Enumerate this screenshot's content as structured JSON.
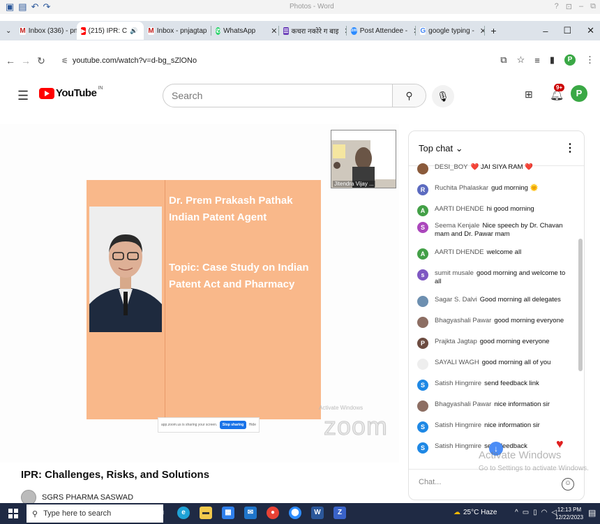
{
  "word": {
    "title": "Photos - Word",
    "qa_icons": [
      "save-icon",
      "undo-icon",
      "redo-icon"
    ],
    "controls": [
      "?",
      "▫",
      "–",
      "▫"
    ]
  },
  "tabs": [
    {
      "icon": "gmail-icon",
      "label": "Inbox (336) - pn",
      "color": "#c5221f"
    },
    {
      "icon": "youtube-icon",
      "label": "(215) IPR: C",
      "color": "#ff0000",
      "active": true
    },
    {
      "icon": "gmail-icon",
      "label": "Inbox - pnjagtap",
      "color": "#c5221f"
    },
    {
      "icon": "whatsapp-icon",
      "label": "WhatsApp",
      "color": "#25d366"
    },
    {
      "icon": "forms-icon",
      "label": "कचरा नकोरे ग बाइ",
      "color": "#673ab7"
    },
    {
      "icon": "zoom-icon",
      "label": "Post Attendee -",
      "color": "#2d8cff"
    },
    {
      "icon": "google-icon",
      "label": "google typing -",
      "color": "#4285f4"
    }
  ],
  "address": {
    "url": "youtube.com/watch?v=d-bg_sZlONo"
  },
  "youtube": {
    "logo_text": "YouTube",
    "region": "IN",
    "search_placeholder": "Search",
    "notif_count": "9+",
    "avatar_letter": "P"
  },
  "slide": {
    "name": "Dr. Prem Prakash Pathak",
    "role": "Indian Patent Agent",
    "topic_line1": "Topic: Case Study on Indian",
    "topic_line2": "Patent Act and Pharmacy",
    "share_text": "app.zoom.us is sharing your screen.",
    "stop_label": "Stop sharing",
    "hide_label": "Hide",
    "thumb_name": "Jitendra Vijay ..."
  },
  "player": {
    "activate_text": "Activate Windows",
    "zoom_watermark": "zoom"
  },
  "chat": {
    "header": "Top chat",
    "input_placeholder": "Chat...",
    "messages": [
      {
        "letter": "",
        "color": "#8a5a3b",
        "author": "DESI_BOY",
        "text": "❤️ JAI SIYA RAM ❤️"
      },
      {
        "letter": "R",
        "color": "#5c6bc0",
        "author": "Ruchita Phalaskar",
        "text": "gud morning 🌞"
      },
      {
        "letter": "A",
        "color": "#43a047",
        "author": "AARTI DHENDE",
        "text": "hi good morning"
      },
      {
        "letter": "S",
        "color": "#ab47bc",
        "author": "Seema Kenjale",
        "text": "Nice speech by Dr. Chavan mam and Dr. Pawar mam"
      },
      {
        "letter": "A",
        "color": "#43a047",
        "author": "AARTI DHENDE",
        "text": "welcome all"
      },
      {
        "letter": "s",
        "color": "#7e57c2",
        "author": "sumit musale",
        "text": "good morning and welcome to all"
      },
      {
        "letter": "",
        "color": "#6d8fb0",
        "author": "Sagar S. Dalvi",
        "text": "Good morning all delegates"
      },
      {
        "letter": "",
        "color": "#8d6e63",
        "author": "Bhagyashali Pawar",
        "text": "good morning everyone"
      },
      {
        "letter": "P",
        "color": "#6d4c41",
        "author": "Prajkta Jagtap",
        "text": "good morning everyone"
      },
      {
        "letter": "",
        "color": "#eeeeee",
        "author": "SAYALI WAGH",
        "text": "good morning all of you"
      },
      {
        "letter": "S",
        "color": "#1e88e5",
        "author": "Satish Hingmire",
        "text": "send feedback link"
      },
      {
        "letter": "",
        "color": "#8d6e63",
        "author": "Bhagyashali Pawar",
        "text": "nice information sir"
      },
      {
        "letter": "S",
        "color": "#1e88e5",
        "author": "Satish Hingmire",
        "text": "nice information sir"
      },
      {
        "letter": "S",
        "color": "#1e88e5",
        "author": "Satish Hingmire",
        "text": "send feedback"
      }
    ],
    "activate_title": "Activate Windows",
    "activate_sub": "Go to Settings to activate Windows."
  },
  "video": {
    "title": "IPR: Challenges, Risks, and Solutions",
    "channel": "SGRS PHARMA SASWAD"
  },
  "taskbar": {
    "search_placeholder": "Type here to search",
    "weather": "25°C  Haze",
    "time": "12:13 PM",
    "date": "12/22/2023"
  }
}
